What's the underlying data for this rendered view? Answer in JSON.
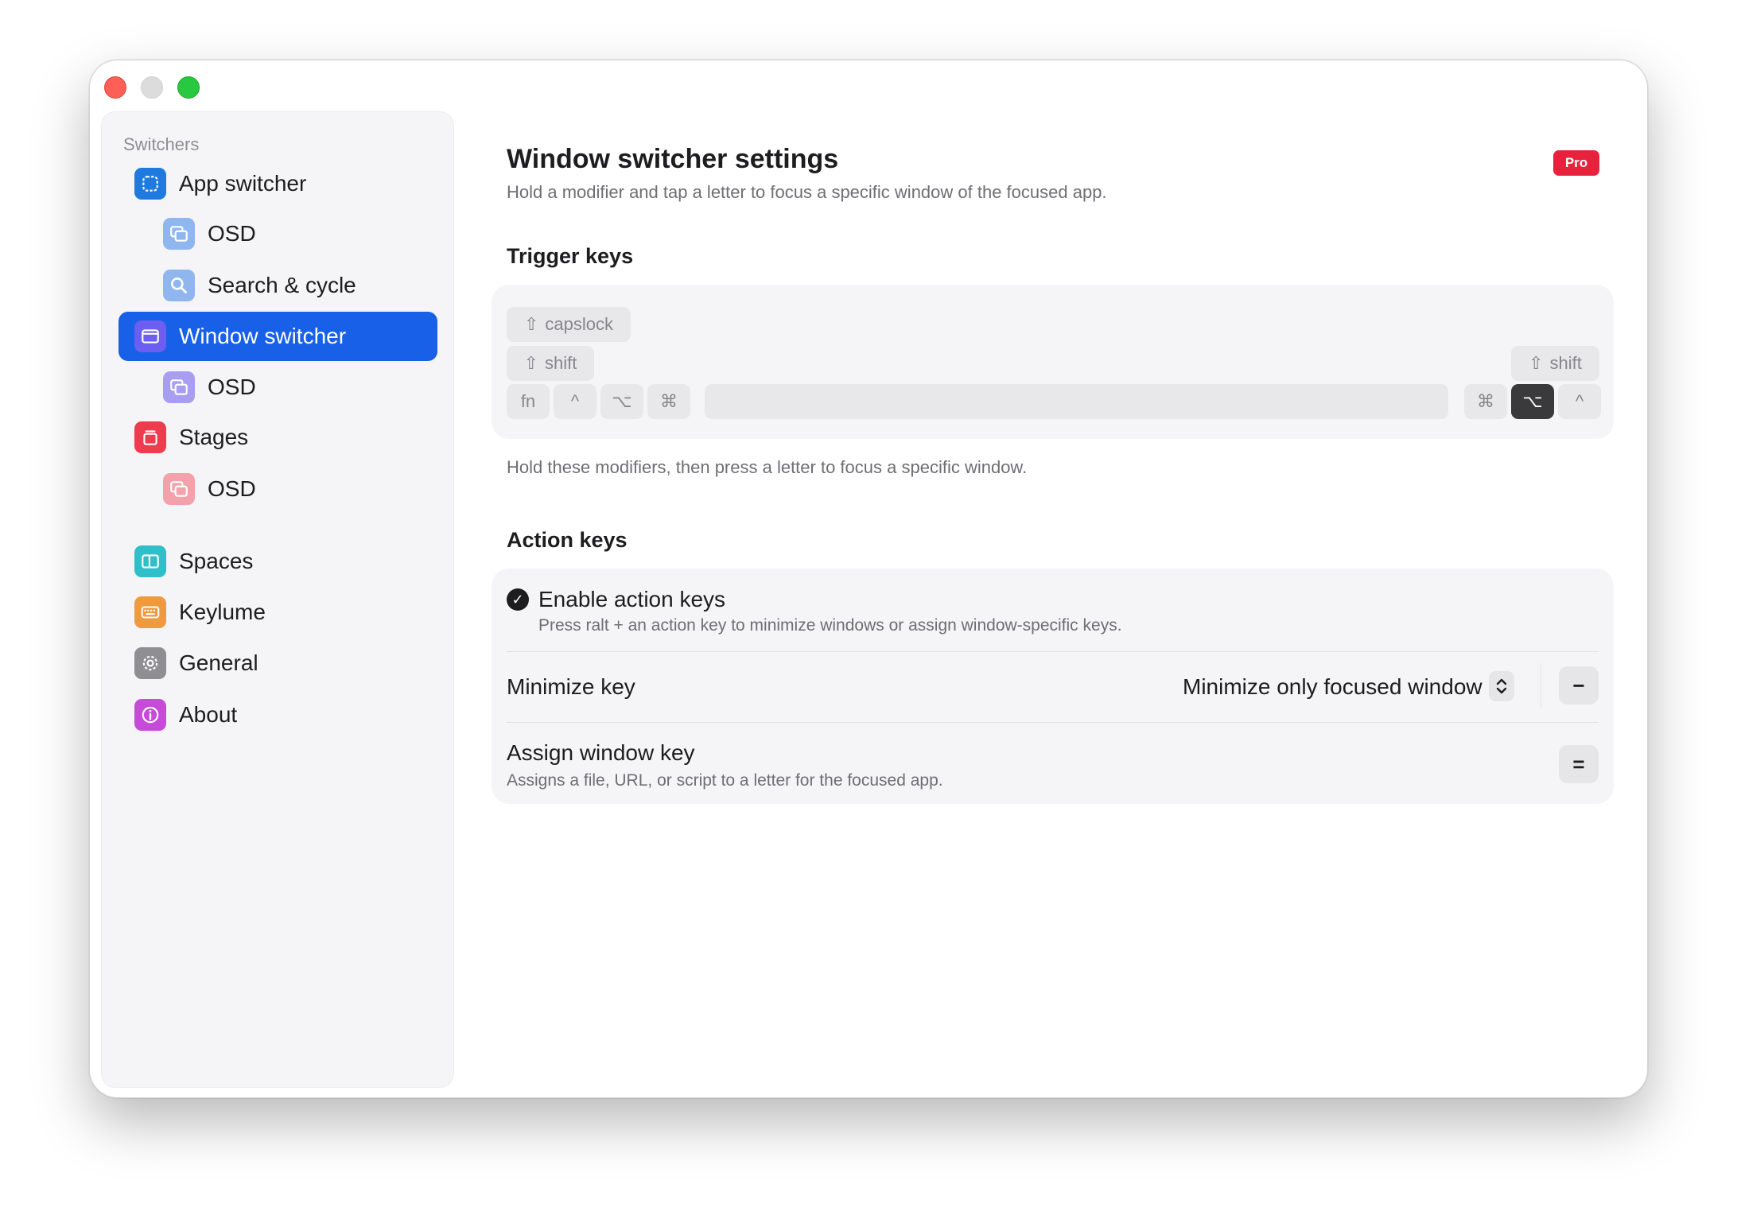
{
  "sidebar": {
    "section_label": "Switchers",
    "items": [
      {
        "label": "App switcher",
        "icon": "app-switcher-icon",
        "color": "#1f7ae0"
      },
      {
        "label": "OSD",
        "icon": "osd-icon",
        "color": "#8fb6ef"
      },
      {
        "label": "Search & cycle",
        "icon": "search-icon",
        "color": "#8fb6ef"
      },
      {
        "label": "Window switcher",
        "icon": "window-icon",
        "color": "#6b5ef0"
      },
      {
        "label": "OSD",
        "icon": "osd-icon",
        "color": "#a79ef2"
      },
      {
        "label": "Stages",
        "icon": "stages-icon",
        "color": "#ee3b4e"
      },
      {
        "label": "OSD",
        "icon": "osd-icon",
        "color": "#f3a1aa"
      },
      {
        "label": "Spaces",
        "icon": "spaces-icon",
        "color": "#2fbfc8"
      },
      {
        "label": "Keylume",
        "icon": "keyboard-icon",
        "color": "#f09a3e"
      },
      {
        "label": "General",
        "icon": "gear-icon",
        "color": "#8e8e93"
      },
      {
        "label": "About",
        "icon": "info-icon",
        "color": "#c64bd9"
      }
    ]
  },
  "main": {
    "title": "Window switcher settings",
    "subtitle": "Hold a modifier and tap a letter to focus a specific window of the focused app.",
    "pro_badge": "Pro",
    "trigger": {
      "heading": "Trigger keys",
      "keys": {
        "capslock": "capslock",
        "shift_left": "shift",
        "fn": "fn",
        "ctrl_left": "^",
        "opt_left": "⌥",
        "cmd_left": "⌘",
        "cmd_right": "⌘",
        "opt_right": "⌥",
        "ctrl_right": "^",
        "shift_right": "shift"
      },
      "hint": "Hold these modifiers, then press a letter to focus a specific window."
    },
    "action": {
      "heading": "Action keys",
      "enable_label": "Enable action keys",
      "enable_sub": "Press ralt + an action key to minimize windows or assign window-specific keys.",
      "minimize_label": "Minimize key",
      "minimize_value": "Minimize only focused window",
      "minimize_key": "−",
      "assign_label": "Assign window key",
      "assign_sub": "Assigns a file, URL, or script to a letter for the focused app.",
      "assign_key": "="
    }
  }
}
